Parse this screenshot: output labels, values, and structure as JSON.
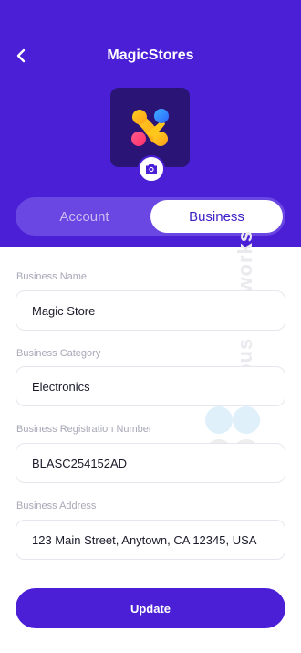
{
  "header": {
    "title": "MagicStores",
    "background_color": "#4a1fd6"
  },
  "tabs": [
    {
      "label": "Account",
      "active": false
    },
    {
      "label": "Business",
      "active": true
    }
  ],
  "fields": [
    {
      "label": "Business Name",
      "value": "Magic Store"
    },
    {
      "label": "Business Category",
      "value": "Electronics"
    },
    {
      "label": "Business Registration Number",
      "value": "BLASC254152AD"
    },
    {
      "label": "Business Address",
      "value": "123 Main Street, Anytown, CA 12345, USA"
    }
  ],
  "update_button": {
    "label": "Update"
  },
  "watermark": {
    "text": "Opus Labworks"
  },
  "icons": {
    "back": "chevron-left-icon",
    "camera": "camera-icon",
    "logo": "magicstores-logo"
  }
}
